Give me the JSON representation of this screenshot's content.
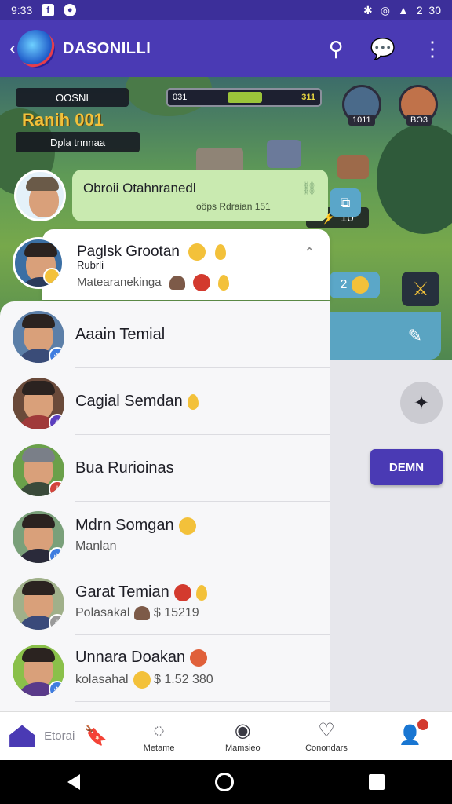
{
  "status_bar": {
    "time": "9:33",
    "battery": "2_30"
  },
  "app_bar": {
    "title": "DASONILLI"
  },
  "game": {
    "hud_name": "OOSNI",
    "rank_title": "Ranih 001",
    "hud_subtitle": "Dpla tnnnaa",
    "xp_left": "031",
    "xp_value": "311",
    "xp_progress": 0.4,
    "avatar_left_label": "1011",
    "avatar_right_label": "BO3",
    "gold_value": "10",
    "pill_value": "2"
  },
  "bubble": {
    "title": "Obroii Otahnranedl",
    "subtitle": "oöps Rdraian 151"
  },
  "featured_chat": {
    "name": "Paglsk Grootan",
    "subname": "Rubrli",
    "status": "Matearanekinga"
  },
  "chats": [
    {
      "name": "Aaain Temial",
      "status": "",
      "badge_color": "#3f7de0"
    },
    {
      "name": "Cagial Semdan",
      "status": "",
      "badge_color": "#5b3fc0"
    },
    {
      "name": "Bua Rurioinas",
      "status": "",
      "badge_color": "#d3443c"
    },
    {
      "name": "Mdrn Somgan",
      "status": "Manlan",
      "badge_color": "#3f7de0"
    },
    {
      "name": "Garat Temian",
      "status": "Polasakal",
      "amount": "$ 15219",
      "badge_color": "#9a9a9a"
    },
    {
      "name": "Unnara Doakan",
      "status": "kolasahal",
      "amount": "$ 1.52 380",
      "badge_color": "#3f7de0"
    }
  ],
  "side": {
    "demo_button": "DEMN"
  },
  "bottom_nav": {
    "home_label": "Etorai",
    "item2": "Metame",
    "item3": "Mamsieo",
    "item4": "Conondars"
  },
  "colors": {
    "primary": "#4a3ab4",
    "bubble": "#c9eab0",
    "teal": "#5aa4c2"
  }
}
